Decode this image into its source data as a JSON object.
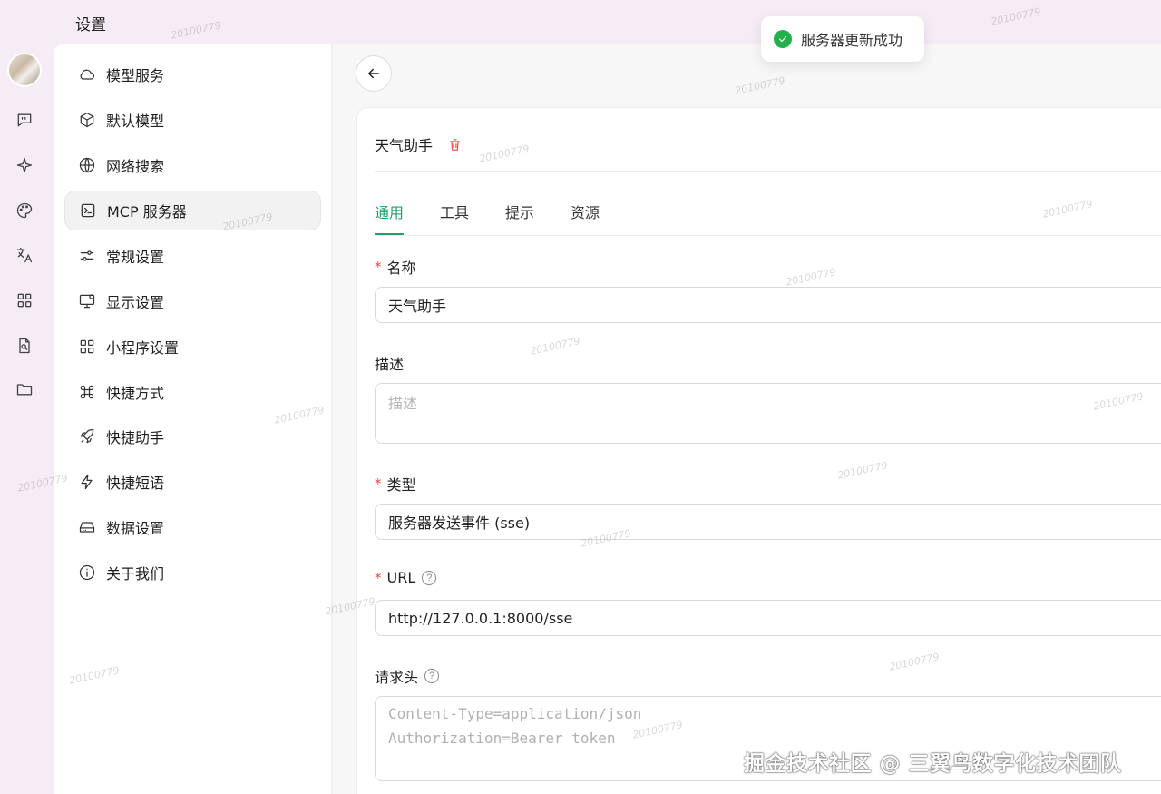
{
  "window": {
    "title": "设置"
  },
  "toast": {
    "message": "服务器更新成功"
  },
  "rail": {
    "icons": [
      "chat-icon",
      "sparkle-icon",
      "palette-icon",
      "translate-icon",
      "apps-icon",
      "file-search-icon",
      "folder-icon"
    ]
  },
  "nav": {
    "items": [
      {
        "label": "模型服务",
        "icon": "cloud-icon"
      },
      {
        "label": "默认模型",
        "icon": "cube-icon"
      },
      {
        "label": "网络搜索",
        "icon": "globe-icon"
      },
      {
        "label": "MCP 服务器",
        "icon": "terminal-icon",
        "active": true
      },
      {
        "label": "常规设置",
        "icon": "sliders-icon"
      },
      {
        "label": "显示设置",
        "icon": "monitor-icon"
      },
      {
        "label": "小程序设置",
        "icon": "grid-icon"
      },
      {
        "label": "快捷方式",
        "icon": "command-icon"
      },
      {
        "label": "快捷助手",
        "icon": "rocket-icon"
      },
      {
        "label": "快捷短语",
        "icon": "zap-icon"
      },
      {
        "label": "数据设置",
        "icon": "drive-icon"
      },
      {
        "label": "关于我们",
        "icon": "info-icon"
      }
    ]
  },
  "server": {
    "title": "天气助手",
    "tabs": [
      "通用",
      "工具",
      "提示",
      "资源"
    ],
    "active_tab": "通用",
    "fields": {
      "name": {
        "label": "名称",
        "required_mark": "*",
        "value": "天气助手"
      },
      "description": {
        "label": "描述",
        "placeholder": "描述"
      },
      "type": {
        "label": "类型",
        "required_mark": "*",
        "value": "服务器发送事件 (sse)"
      },
      "url": {
        "label": "URL",
        "required_mark": "*",
        "value": "http://127.0.0.1:8000/sse"
      },
      "headers": {
        "label": "请求头",
        "placeholder_line1": "Content-Type=application/json",
        "placeholder_line2": "Authorization=Bearer token"
      }
    }
  },
  "watermark": {
    "text": "20100779"
  },
  "credit": {
    "text": "掘金技术社区 @ 三翼鸟数字化技术团队"
  },
  "colors": {
    "accent": "#22a06b",
    "danger": "#e5484d",
    "success": "#22b04b",
    "background": "#f5ecf6"
  }
}
